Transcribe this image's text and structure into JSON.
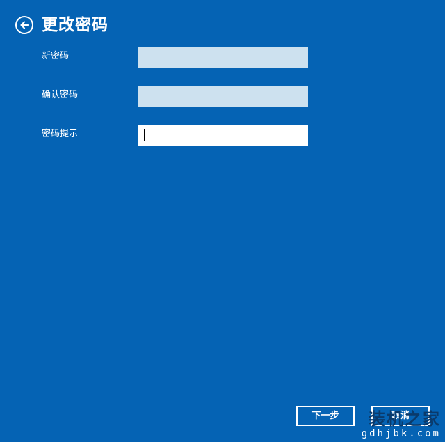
{
  "header": {
    "title": "更改密码",
    "back_icon": "back-arrow-icon"
  },
  "form": {
    "new_password": {
      "label": "新密码",
      "value": ""
    },
    "confirm_password": {
      "label": "确认密码",
      "value": ""
    },
    "password_hint": {
      "label": "密码提示",
      "value": ""
    }
  },
  "footer": {
    "next_label": "下一步",
    "cancel_label": "取消"
  },
  "watermark": {
    "top": "装机之家",
    "bottom": "gdhjbk.com"
  },
  "colors": {
    "background": "#0563b4",
    "input_disabled": "#cde1ef",
    "input_active": "#ffffff"
  }
}
